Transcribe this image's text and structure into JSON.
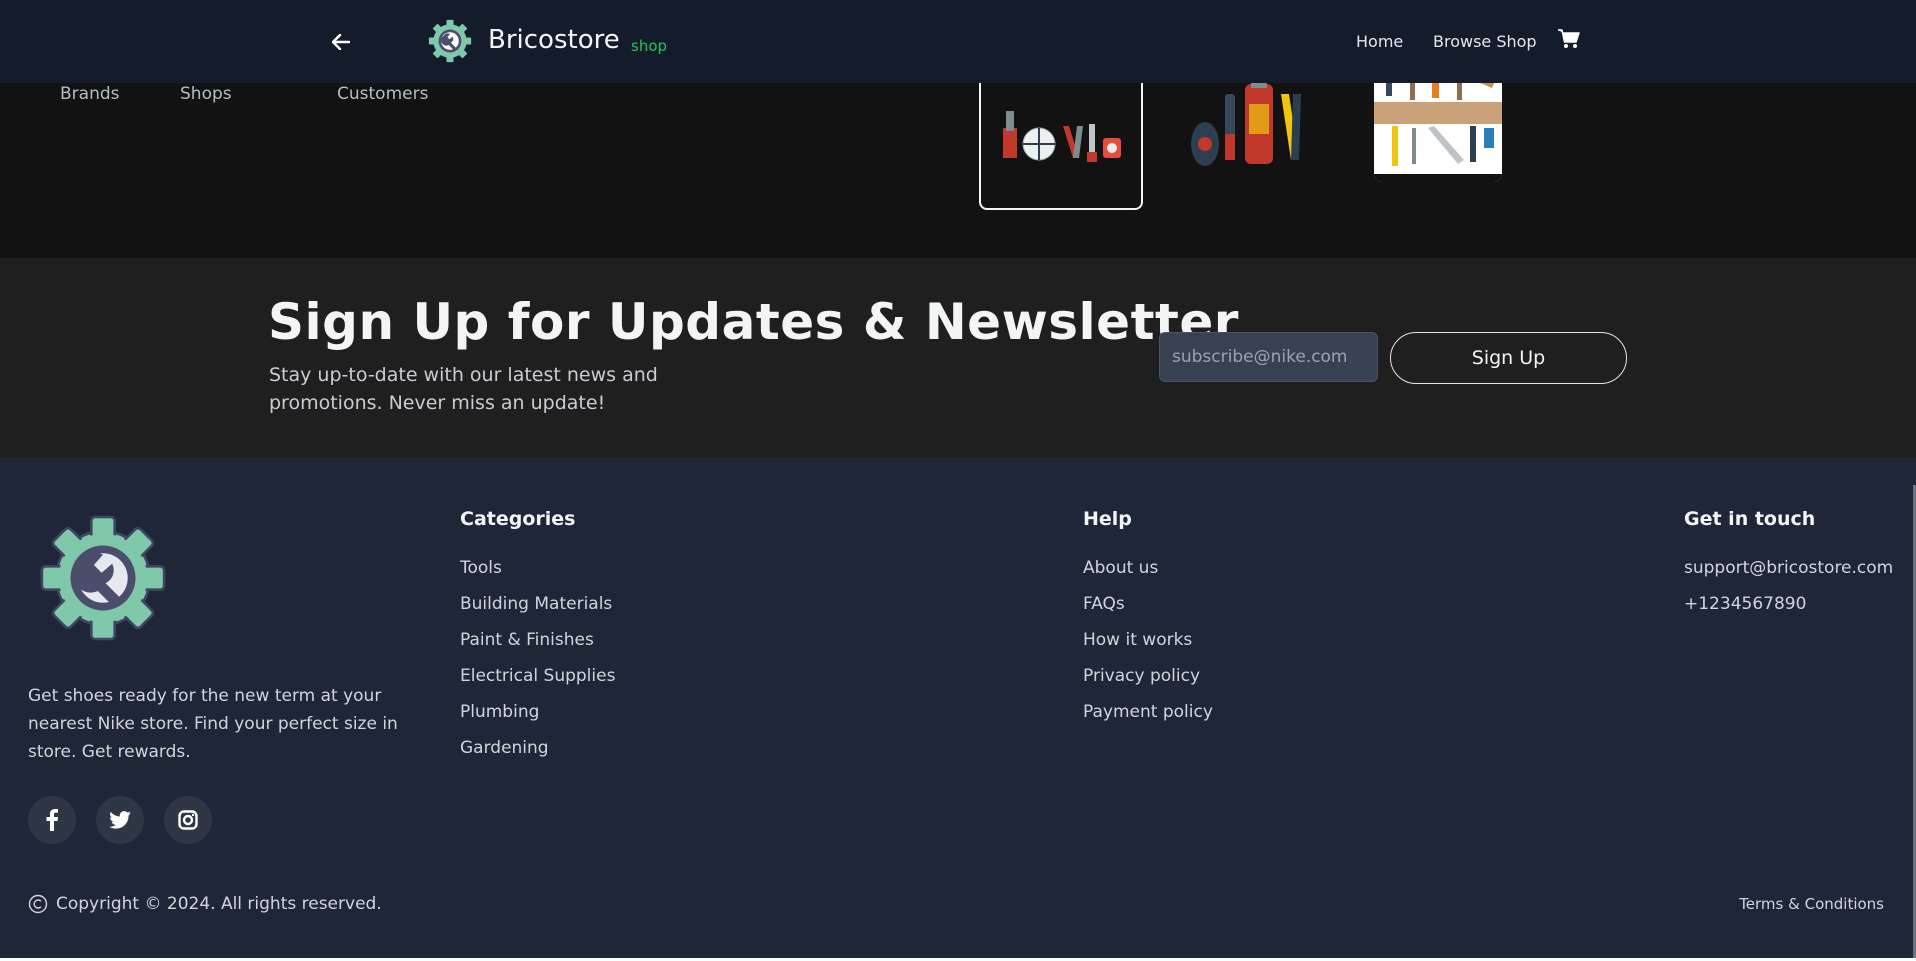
{
  "navbar": {
    "brand": "Bricostore",
    "brand_tag": "shop",
    "links": {
      "home": "Home",
      "browse": "Browse Shop"
    },
    "icons": {
      "back": "arrow-left-icon",
      "cart": "cart-icon",
      "logo": "wrench-gear-icon"
    }
  },
  "hero": {
    "stats": {
      "brands": "Brands",
      "shops": "Shops",
      "customers": "Customers"
    }
  },
  "newsletter": {
    "title": "Sign Up for Updates & Newsletter",
    "subtitle": "Stay up-to-date with our latest news and promotions. Never miss an update!",
    "placeholder": "subscribe@nike.com",
    "button": "Sign Up"
  },
  "footer": {
    "description": "Get shoes ready for the new term at your nearest Nike store. Find your perfect size in store. Get rewards.",
    "categories": {
      "title": "Categories",
      "items": [
        "Tools",
        "Building Materials",
        "Paint & Finishes",
        "Electrical Supplies",
        "Plumbing",
        "Gardening"
      ]
    },
    "help": {
      "title": "Help",
      "items": [
        "About us",
        "FAQs",
        "How it works",
        "Privacy policy",
        "Payment policy"
      ]
    },
    "contact": {
      "title": "Get in touch",
      "items": [
        "support@bricostore.com",
        "+1234567890"
      ]
    },
    "copyright": "Copyright © 2024. All rights reserved.",
    "terms": "Terms & Conditions",
    "social_icons": [
      "facebook-icon",
      "twitter-icon",
      "instagram-icon"
    ]
  },
  "colors": {
    "navbar_bg": "#141b2b",
    "hero_bg": "#121212",
    "newsletter_bg": "#1f1f1f",
    "footer_bg": "#1f2637",
    "accent_green": "#22c55e",
    "logo_gear": "#7fc8a9",
    "logo_face": "#4a4e6b"
  }
}
